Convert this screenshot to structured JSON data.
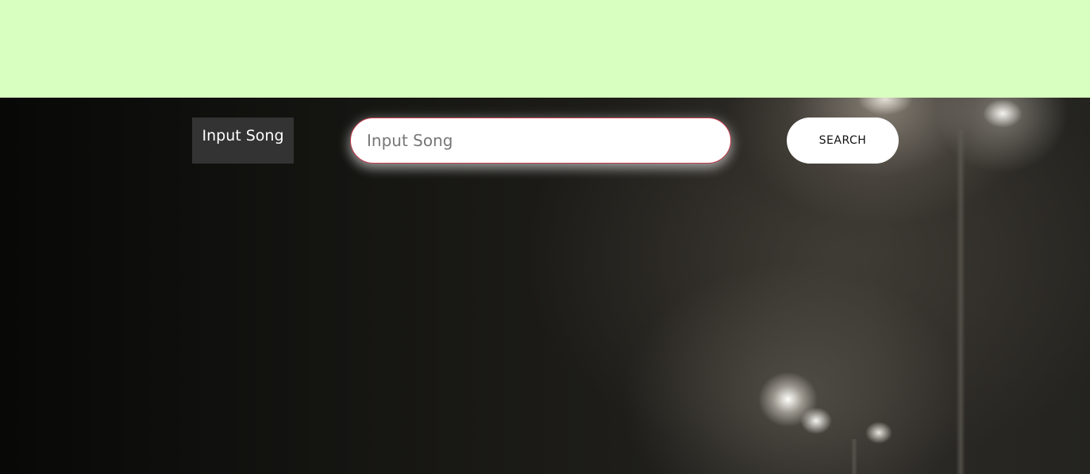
{
  "colors": {
    "top_band": "#d8ffbf",
    "label_bg": "#333333",
    "input_border": "#c0394b",
    "button_bg": "#ffffff"
  },
  "search": {
    "label": "Input Song",
    "input_value": "",
    "placeholder": "Input Song",
    "button_label": "SEARCH"
  }
}
